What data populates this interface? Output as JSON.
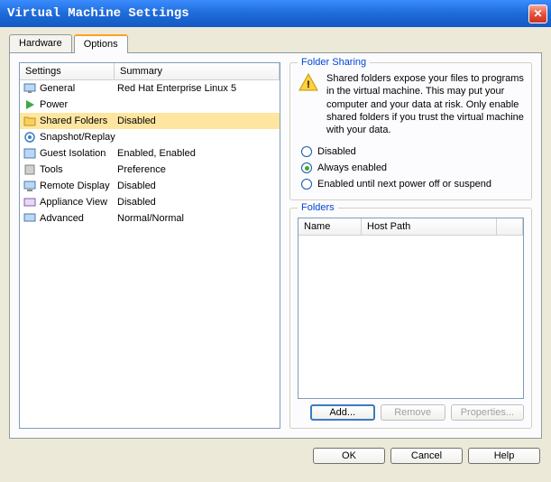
{
  "window": {
    "title": "Virtual Machine Settings"
  },
  "tabs": {
    "hardware": "Hardware",
    "options": "Options"
  },
  "list": {
    "header": {
      "settings": "Settings",
      "summary": "Summary"
    },
    "items": [
      {
        "label": "General",
        "summary": "Red Hat Enterprise Linux 5"
      },
      {
        "label": "Power",
        "summary": ""
      },
      {
        "label": "Shared Folders",
        "summary": "Disabled"
      },
      {
        "label": "Snapshot/Replay",
        "summary": ""
      },
      {
        "label": "Guest Isolation",
        "summary": "Enabled, Enabled"
      },
      {
        "label": "Tools",
        "summary": "Preference"
      },
      {
        "label": "Remote Display",
        "summary": "Disabled"
      },
      {
        "label": "Appliance View",
        "summary": "Disabled"
      },
      {
        "label": "Advanced",
        "summary": "Normal/Normal"
      }
    ]
  },
  "folderSharing": {
    "title": "Folder Sharing",
    "warning": "Shared folders expose your files to programs in the virtual machine. This may put your computer and your data at risk. Only enable shared folders if you trust the virtual machine with your data.",
    "radios": {
      "disabled": "Disabled",
      "always": "Always enabled",
      "until": "Enabled until next power off or suspend"
    }
  },
  "folders": {
    "title": "Folders",
    "header": {
      "name": "Name",
      "hostPath": "Host Path"
    },
    "buttons": {
      "add": "Add...",
      "remove": "Remove",
      "properties": "Properties..."
    }
  },
  "dialog": {
    "ok": "OK",
    "cancel": "Cancel",
    "help": "Help"
  }
}
